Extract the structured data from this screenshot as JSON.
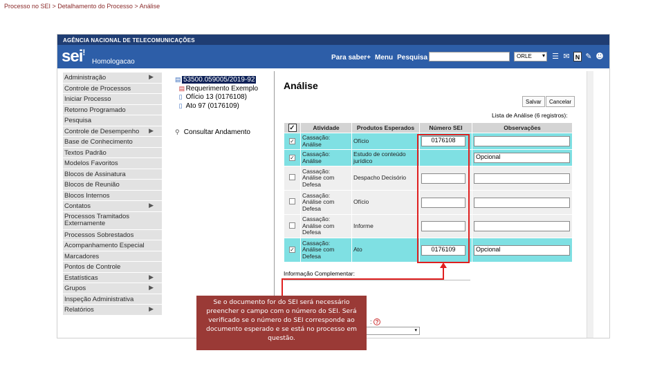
{
  "breadcrumb": "Processo no SEI > Detalhamento do Processo > Análise",
  "header": {
    "agency": "AGÊNCIA NACIONAL DE TELECOMUNICAÇÕES",
    "logo": "sei",
    "environment": "Homologacao",
    "nav": [
      "Para saber+",
      "Menu",
      "Pesquisa"
    ],
    "search_value": "",
    "unit": "ORLE",
    "icons": [
      "list-icon",
      "envelope-icon",
      "n-icon",
      "tools-icon",
      "user-icon"
    ],
    "n_icon_label": "N"
  },
  "sidebar": {
    "items": [
      {
        "label": "Administração",
        "sub": true
      },
      {
        "label": "Controle de Processos",
        "sub": false
      },
      {
        "label": "Iniciar Processo",
        "sub": false
      },
      {
        "label": "Retorno Programado",
        "sub": false
      },
      {
        "label": "Pesquisa",
        "sub": false
      },
      {
        "label": "Controle de Desempenho",
        "sub": true
      },
      {
        "label": "Base de Conhecimento",
        "sub": false
      },
      {
        "label": "Textos Padrão",
        "sub": false
      },
      {
        "label": "Modelos Favoritos",
        "sub": false
      },
      {
        "label": "Blocos de Assinatura",
        "sub": false
      },
      {
        "label": "Blocos de Reunião",
        "sub": false
      },
      {
        "label": "Blocos Internos",
        "sub": false
      },
      {
        "label": "Contatos",
        "sub": true
      },
      {
        "label": "Processos Tramitados Externamente",
        "sub": false,
        "tall": true
      },
      {
        "label": "Processos Sobrestados",
        "sub": false
      },
      {
        "label": "Acompanhamento Especial",
        "sub": false
      },
      {
        "label": "Marcadores",
        "sub": false
      },
      {
        "label": "Pontos de Controle",
        "sub": false
      },
      {
        "label": "Estatísticas",
        "sub": true
      },
      {
        "label": "Grupos",
        "sub": true
      },
      {
        "label": "Inspeção Administrativa",
        "sub": false
      },
      {
        "label": "Relatórios",
        "sub": true
      }
    ]
  },
  "tree": {
    "process": "53500.059005/2019-92",
    "docs": [
      {
        "label": "Requerimento Exemplo",
        "icon": "pdf-icon"
      },
      {
        "label": "Ofício 13 (0176108)",
        "icon": "document-icon"
      },
      {
        "label": "Ato 97 (0176109)",
        "icon": "document-icon"
      }
    ],
    "consult": "Consultar Andamento"
  },
  "main": {
    "title": "Análise",
    "btn_save": "Salvar",
    "btn_cancel": "Cancelar",
    "list_caption": "Lista de Análise (6 registros):",
    "columns": [
      "",
      "Atividade",
      "Produtos Esperados",
      "Número SEI",
      "Observações"
    ],
    "rows": [
      {
        "selected": true,
        "activity": "Cassação: Análise",
        "product": "Ofício",
        "sei": "0176108",
        "obs": ""
      },
      {
        "selected": true,
        "activity": "Cassação: Análise",
        "product": "Estudo de conteúdo jurídico",
        "sei": null,
        "obs": "Opcional"
      },
      {
        "selected": false,
        "activity": "Cassação: Análise com Defesa",
        "product": "Despacho Decisório",
        "sei": "",
        "obs": ""
      },
      {
        "selected": false,
        "activity": "Cassação: Análise com Defesa",
        "product": "Ofício",
        "sei": "",
        "obs": ""
      },
      {
        "selected": false,
        "activity": "Cassação: Análise com Defesa",
        "product": "Informe",
        "sei": "",
        "obs": ""
      },
      {
        "selected": true,
        "activity": "Cassação: Análise com Defesa",
        "product": "Ato",
        "sei": "0176109",
        "obs": "Opcional"
      }
    ],
    "info_label": "Informação Complementar:",
    "help_label": "?"
  },
  "callout": "Se o documento for do SEI será necessário preencher o campo com o número do SEI. Será verificado se o número do SEI corresponde ao documento esperado e se está no processo em questão.",
  "colors": {
    "header": "#2d5ea8",
    "agency": "#1f3d73",
    "selected_row": "#7fe0e3",
    "highlight": "#e01f1f",
    "callout": "#9a3a36"
  }
}
